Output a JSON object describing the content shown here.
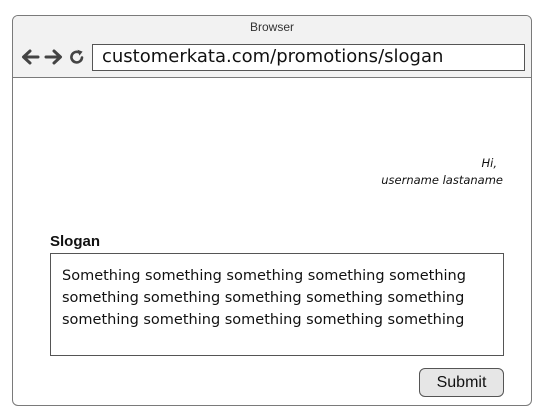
{
  "window": {
    "title": "Browser"
  },
  "toolbar": {
    "back_icon": "arrow-left-icon",
    "forward_icon": "arrow-right-icon",
    "reload_icon": "reload-icon"
  },
  "address_bar": {
    "url": "customerkata.com/promotions/slogan"
  },
  "greeting": {
    "hi": "Hi,",
    "username": "username lastaname"
  },
  "form": {
    "slogan_label": "Slogan",
    "slogan_lines": [
      "Something something something something something",
      "something something something something something",
      "something something something something something"
    ],
    "submit_label": "Submit"
  },
  "colors": {
    "chrome_background": "#f2f2f2",
    "border": "#555555",
    "button_background": "#e6e6e6"
  }
}
